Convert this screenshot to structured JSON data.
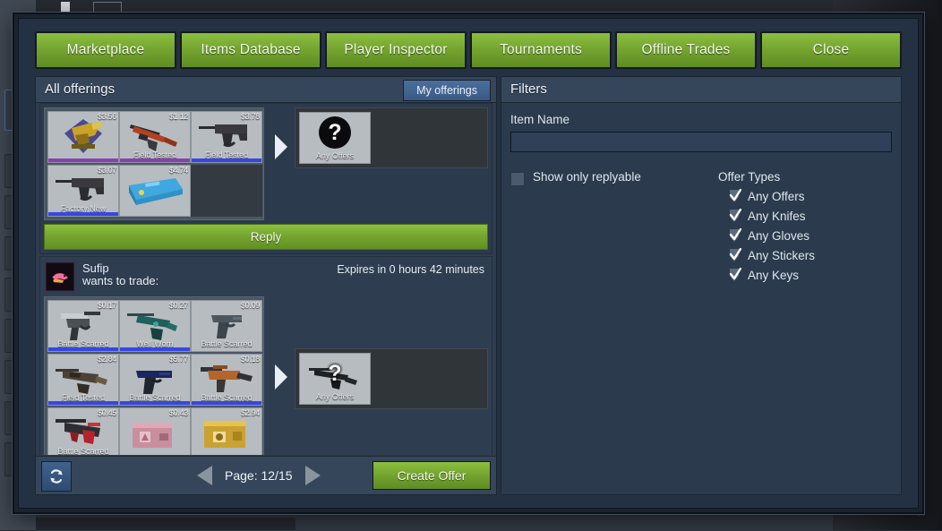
{
  "tabs": [
    {
      "label": "Marketplace"
    },
    {
      "label": "Items Database"
    },
    {
      "label": "Player Inspector"
    },
    {
      "label": "Tournaments"
    },
    {
      "label": "Offline Trades"
    },
    {
      "label": "Close"
    }
  ],
  "left_panel": {
    "title": "All offerings",
    "my_offerings_label": "My offerings"
  },
  "offers": [
    {
      "user": "",
      "wants_label": "",
      "expires": "",
      "items": [
        {
          "price": "$3.56",
          "wear": "",
          "rarity": "purple",
          "icon": "trophy-badge"
        },
        {
          "price": "$1.12",
          "wear": "Field Tested",
          "rarity": "purple",
          "icon": "rifle-ak"
        },
        {
          "price": "$3.78",
          "wear": "Field Tested",
          "rarity": "blue",
          "icon": "rifle-famas"
        },
        {
          "price": "$3.07",
          "wear": "Factory New",
          "rarity": "blue",
          "icon": "rifle-famas"
        },
        {
          "price": "$4.74",
          "wear": "",
          "rarity": "none",
          "icon": "case-blue"
        }
      ],
      "any_offers_label": "Any Offers",
      "any_offers_icon": "question-mark",
      "reply_label": "Reply"
    },
    {
      "user": "Sufip",
      "wants_label": "wants to trade:",
      "expires": "Expires in 0 hours 42 minutes",
      "items": [
        {
          "price": "$0.17",
          "wear": "Battle Scarred",
          "rarity": "blue",
          "icon": "smg-mp7"
        },
        {
          "price": "$0.27",
          "wear": "Well Worn",
          "rarity": "blue",
          "icon": "rifle-teal"
        },
        {
          "price": "$0.09",
          "wear": "Battle Scarred",
          "rarity": "none",
          "icon": "pistol-fiveseven"
        },
        {
          "price": "$2.84",
          "wear": "Field Tested",
          "rarity": "blue",
          "icon": "rifle-rust"
        },
        {
          "price": "$5.77",
          "wear": "Battle Scarred",
          "rarity": "blue",
          "icon": "pistol-glock"
        },
        {
          "price": "$0.18",
          "wear": "Battle Scarred",
          "rarity": "blue",
          "icon": "smg-ump-orange"
        },
        {
          "price": "$0.45",
          "wear": "Battle Scarred",
          "rarity": "blue",
          "icon": "mg-red"
        },
        {
          "price": "$0.43",
          "wear": "",
          "rarity": "none",
          "icon": "case-pink"
        },
        {
          "price": "$2.94",
          "wear": "",
          "rarity": "none",
          "icon": "case-gold"
        }
      ],
      "any_offers_label": "Any Offers",
      "any_offers_icon": "question-mark-weapon",
      "reply_label": ""
    }
  ],
  "bottom_bar": {
    "refresh_icon": "refresh-icon",
    "prev_icon": "arrow-left-icon",
    "next_icon": "arrow-right-icon",
    "page_label": "Page: 12/15",
    "create_offer_label": "Create Offer"
  },
  "filters": {
    "title": "Filters",
    "item_name_label": "Item Name",
    "item_name_value": "",
    "item_name_placeholder": "",
    "show_only_replyable_label": "Show only replyable",
    "show_only_replyable_checked": false,
    "offer_types_title": "Offer Types",
    "offer_types": [
      {
        "label": "Any Offers",
        "checked": true
      },
      {
        "label": "Any Knifes",
        "checked": true
      },
      {
        "label": "Any Gloves",
        "checked": true
      },
      {
        "label": "Any Stickers",
        "checked": true
      },
      {
        "label": "Any Keys",
        "checked": true
      }
    ]
  },
  "colors": {
    "accent_green": "#74a42f",
    "panel_blue": "#2e3c4e",
    "header_blue": "#36465a",
    "button_blue": "#3a5a84",
    "rarity_blue": "#3546e8",
    "rarity_purple": "#8a3fb5"
  }
}
